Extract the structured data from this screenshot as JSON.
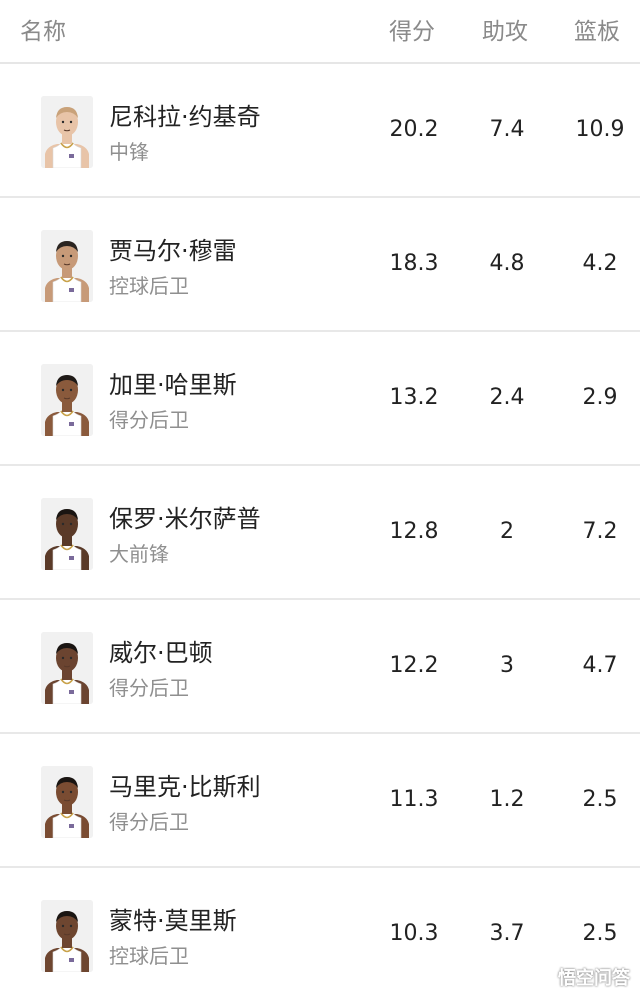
{
  "header": {
    "name": "名称",
    "points": "得分",
    "assists": "助攻",
    "rebounds": "篮板"
  },
  "players": [
    {
      "name": "尼科拉·约基奇",
      "position": "中锋",
      "points": "20.2",
      "assists": "7.4",
      "rebounds": "10.9",
      "skin": "#e8c4a8",
      "hair": "#c9a27a"
    },
    {
      "name": "贾马尔·穆雷",
      "position": "控球后卫",
      "points": "18.3",
      "assists": "4.8",
      "rebounds": "4.2",
      "skin": "#c79a78",
      "hair": "#2a2420"
    },
    {
      "name": "加里·哈里斯",
      "position": "得分后卫",
      "points": "13.2",
      "assists": "2.4",
      "rebounds": "2.9",
      "skin": "#8a5a3c",
      "hair": "#1f1a17"
    },
    {
      "name": "保罗·米尔萨普",
      "position": "大前锋",
      "points": "12.8",
      "assists": "2",
      "rebounds": "7.2",
      "skin": "#5a3a28",
      "hair": "#1a1512"
    },
    {
      "name": "威尔·巴顿",
      "position": "得分后卫",
      "points": "12.2",
      "assists": "3",
      "rebounds": "4.7",
      "skin": "#6b4430",
      "hair": "#1a1512"
    },
    {
      "name": "马里克·比斯利",
      "position": "得分后卫",
      "points": "11.3",
      "assists": "1.2",
      "rebounds": "2.5",
      "skin": "#7a4c32",
      "hair": "#1a1512"
    },
    {
      "name": "蒙特·莫里斯",
      "position": "控球后卫",
      "points": "10.3",
      "assists": "3.7",
      "rebounds": "2.5",
      "skin": "#6e4630",
      "hair": "#1a1512"
    }
  ],
  "watermark": {
    "text": "悟空问答",
    "icon": "wukong-logo-icon"
  }
}
